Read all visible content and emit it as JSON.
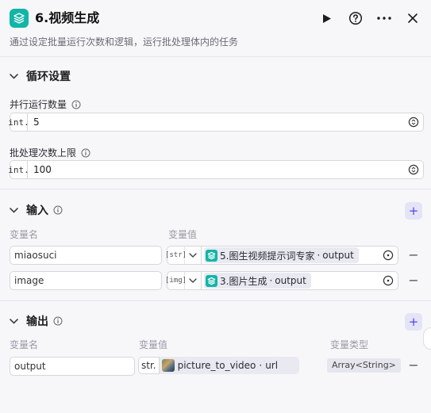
{
  "header": {
    "title": "6.视频生成",
    "description": "通过设定批量运行次数和逻辑，运行批处理体内的任务"
  },
  "loop_settings": {
    "section_title": "循环设置",
    "parallel": {
      "label": "并行运行数量",
      "type_tag": "int.",
      "value": "5"
    },
    "batch_limit": {
      "label": "批处理次数上限",
      "type_tag": "int.",
      "value": "100"
    }
  },
  "inputs": {
    "section_title": "输入",
    "col_name": "变量名",
    "col_value": "变量值",
    "rows": [
      {
        "name": "miaosuci",
        "type_tag": "[str]",
        "ref_node": "5.图生视频提示词专家",
        "ref_field": "output"
      },
      {
        "name": "image",
        "type_tag": "[img]",
        "ref_node": "3.图片生成",
        "ref_field": "output"
      }
    ]
  },
  "outputs": {
    "section_title": "输出",
    "col_name": "变量名",
    "col_value": "变量值",
    "col_type": "变量类型",
    "rows": [
      {
        "name": "output",
        "type_tag": "str.",
        "ref_node": "picture_to_video",
        "ref_field": "url",
        "var_type": "Array<String>"
      }
    ]
  },
  "icons": {
    "node": "layers-icon",
    "run": "play-icon",
    "help": "question-circle-icon",
    "more": "more-horizontal-icon",
    "close": "close-icon"
  },
  "colors": {
    "accent_teal": "#12b5a6",
    "accent_purple": "#5046e5",
    "background": "#f7f7fa"
  }
}
